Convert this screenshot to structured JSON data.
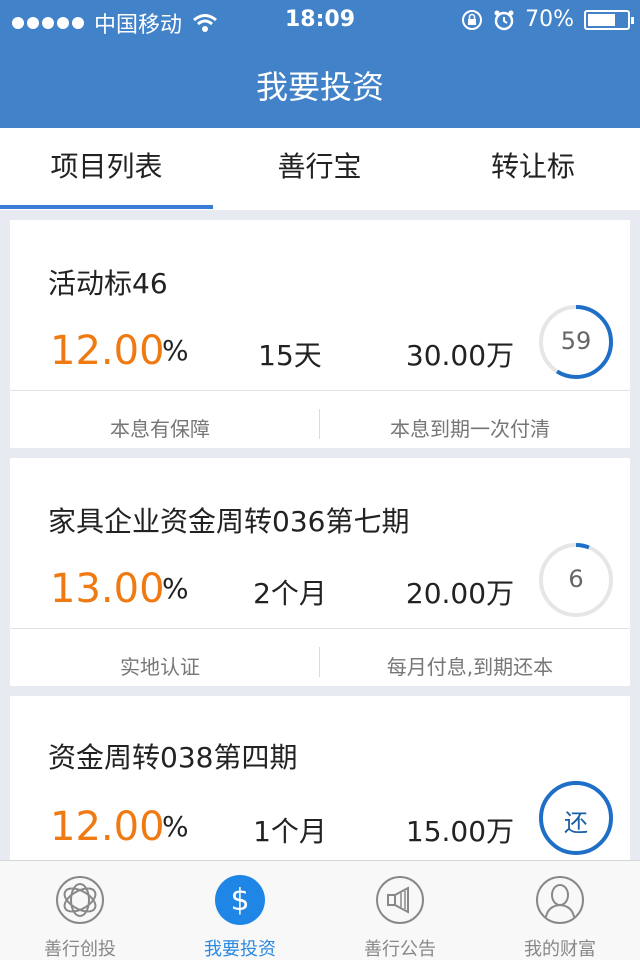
{
  "status_bar": {
    "carrier": "中国移动",
    "time": "18:09",
    "battery": "70%",
    "battery_level": 0.7
  },
  "nav": {
    "title": "我要投资"
  },
  "tabs": [
    {
      "label": "项目列表",
      "active": true
    },
    {
      "label": "善行宝",
      "active": false
    },
    {
      "label": "转让标",
      "active": false
    }
  ],
  "projects": [
    {
      "title": "活动标46",
      "rate": "12.00",
      "rate_unit": "%",
      "term": "15天",
      "amount": "30.00万",
      "progress_label": "59",
      "progress": 0.59,
      "tag_left": "本息有保障",
      "tag_right": "本息到期一次付清"
    },
    {
      "title": "家具企业资金周转036第七期",
      "rate": "13.00",
      "rate_unit": "%",
      "term": "2个月",
      "amount": "20.00万",
      "progress_label": "6",
      "progress": 0.06
    },
    {
      "title": "资金周转038第四期",
      "rate": "12.00",
      "rate_unit": "%",
      "term": "1个月",
      "amount": "15.00万",
      "progress_label": "还",
      "progress": 1.0
    }
  ],
  "project2_tags": {
    "left": "实地认证",
    "right": "每月付息,到期还本"
  },
  "tabbar": [
    {
      "label": "善行创投",
      "icon": "venture-logo-icon",
      "active": false
    },
    {
      "label": "我要投资",
      "icon": "dollar-icon",
      "active": true
    },
    {
      "label": "善行公告",
      "icon": "megaphone-icon",
      "active": false
    },
    {
      "label": "我的财富",
      "icon": "user-icon",
      "active": false
    }
  ],
  "colors": {
    "brand_blue": "#4282c8",
    "rate_orange": "#f07a12",
    "ring_blue": "#1e6fc8",
    "active_tab": "#2a8ae0"
  }
}
